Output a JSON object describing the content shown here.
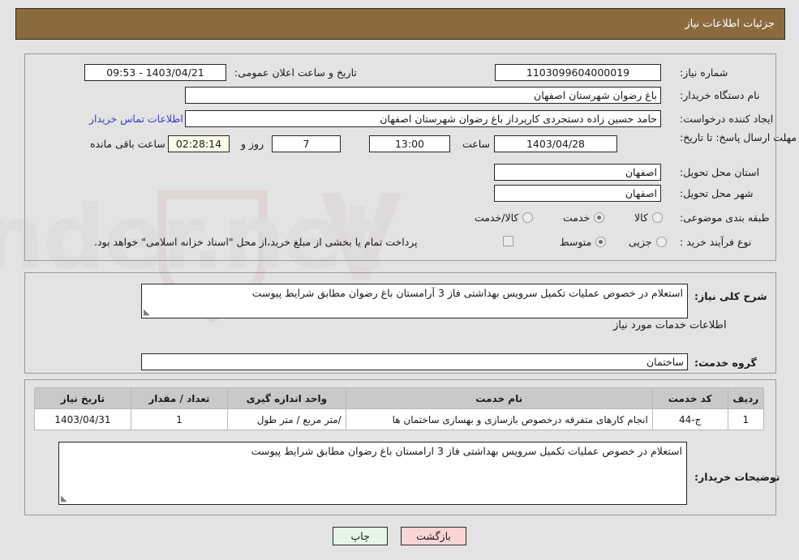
{
  "header": {
    "title": "جزئیات اطلاعات نیاز"
  },
  "info": {
    "need_number_label": "شماره نیاز:",
    "need_number_value": "1103099604000019",
    "announce_label": "تاریخ و ساعت اعلان عمومی:",
    "announce_value": "1403/04/21 - 09:53",
    "buyer_org_label": "نام دستگاه خریدار:",
    "buyer_org_value": "باغ رضوان شهرستان اصفهان",
    "creator_label": "ایجاد کننده درخواست:",
    "creator_value": "حامد حسین زاده دستجردی کارپرداز باغ رضوان شهرستان اصفهان",
    "contact_link": "اطلاعات تماس خریدار",
    "deadline_label": "مهلت ارسال پاسخ: تا تاریخ:",
    "deadline_date": "1403/04/28",
    "deadline_hour_label": "ساعت",
    "deadline_hour_value": "13:00",
    "days_value": "7",
    "days_label": "روز و",
    "timer_value": "02:28:14",
    "timer_label": "ساعت باقی مانده",
    "province_label": "استان محل تحویل:",
    "province_value": "اصفهان",
    "city_label": "شهر محل تحویل:",
    "city_value": "اصفهان",
    "category_label": "طبقه بندی موضوعی:",
    "category_options": [
      {
        "label": "کالا",
        "selected": false
      },
      {
        "label": "خدمت",
        "selected": true
      },
      {
        "label": "کالا/خدمت",
        "selected": false
      }
    ],
    "process_label": "نوع فرآیند خرید :",
    "process_options": [
      {
        "label": "جزیی",
        "selected": false
      },
      {
        "label": "متوسط",
        "selected": true
      }
    ],
    "treasury_checkbox_checked": false,
    "treasury_text": "پرداخت تمام یا بخشی از مبلغ خرید،از محل \"اسناد خزانه اسلامی\" خواهد بود."
  },
  "summary": {
    "label": "شرح کلی نیاز:",
    "value": "استعلام در خصوص عملیات تکمیل سرویس بهداشتی فاز 3 آرامستان باغ رضوان مطابق شرایط پیوست",
    "services_heading": "اطلاعات خدمات مورد نیاز",
    "service_group_label": "گروه خدمت:",
    "service_group_value": "ساختمان"
  },
  "table": {
    "columns": [
      "ردیف",
      "کد خدمت",
      "نام خدمت",
      "واحد اندازه گیری",
      "تعداد / مقدار",
      "تاریخ نیاز"
    ],
    "rows": [
      {
        "row": "1",
        "code": "ج-44",
        "name": "انجام کارهای متفرقه درخصوص بازسازی و بهسازی ساختمان ها",
        "unit": "/متر مربع / متر طول",
        "quantity": "1",
        "date": "1403/04/31"
      }
    ]
  },
  "buyer_notes": {
    "label": "توضیحات خریدار:",
    "value": "استعلام در خصوص عملیات تکمیل سرویس بهداشتی فاز 3 ارامستان باغ رضوان مطابق شرایط پیوست"
  },
  "buttons": {
    "print": "چاپ",
    "back": "بازگشت"
  },
  "watermark": {
    "text": "AriaTender.net"
  },
  "colors": {
    "header_bar": "#8b6b3d",
    "page_bg": "#e3e3e3",
    "link": "#3c3cc8",
    "table_header": "#c9c9c9",
    "btn_print": "#e6f6e6",
    "btn_back": "#fbd5d5",
    "timer_bg": "#fbfbe8"
  }
}
